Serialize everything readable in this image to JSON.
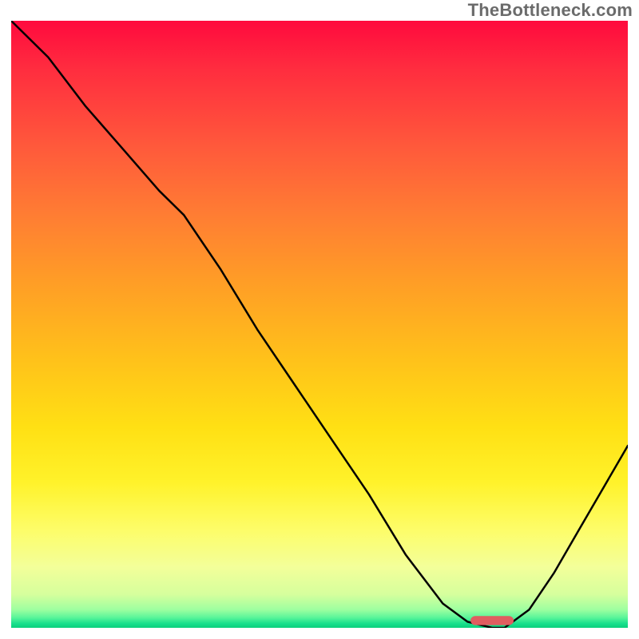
{
  "attribution": "TheBottleneck.com",
  "colors": {
    "curve": "#000000",
    "marker": "#e05d60"
  },
  "chart_data": {
    "type": "line",
    "title": "",
    "xlabel": "",
    "ylabel": "",
    "xlim": [
      0,
      100
    ],
    "ylim": [
      0,
      100
    ],
    "series": [
      {
        "name": "bottleneck_curve",
        "x": [
          0,
          6,
          12,
          18,
          24,
          28,
          34,
          40,
          46,
          52,
          58,
          64,
          70,
          74,
          78,
          80,
          84,
          88,
          92,
          96,
          100
        ],
        "y": [
          100,
          94,
          86,
          79,
          72,
          68,
          59,
          49,
          40,
          31,
          22,
          12,
          4,
          1,
          0,
          0,
          3,
          9,
          16,
          23,
          30
        ]
      }
    ],
    "marker": {
      "name": "optimal_range",
      "x_start": 74.5,
      "x_end": 81.5,
      "y": 1.2,
      "height": 1.5
    },
    "gradient": {
      "top": "#ff0a3e",
      "mid": "#ffe014",
      "bottom": "#0bcf7d"
    }
  }
}
